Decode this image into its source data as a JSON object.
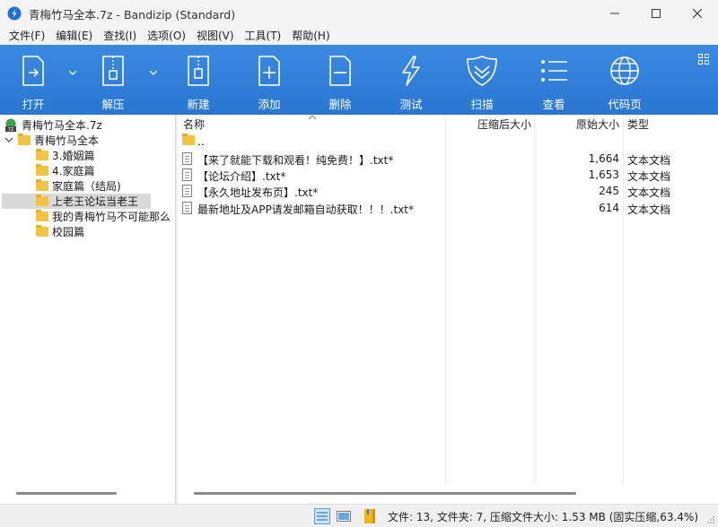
{
  "window": {
    "title": "青梅竹马全本.7z - Bandizip (Standard)"
  },
  "menu": [
    "文件(F)",
    "编辑(E)",
    "查找(I)",
    "选项(O)",
    "视图(V)",
    "工具(T)",
    "帮助(H)"
  ],
  "toolbar": {
    "items": [
      {
        "label": "打开",
        "icon": "open-icon"
      },
      {
        "label": "解压",
        "icon": "extract-icon"
      },
      {
        "label": "新建",
        "icon": "new-archive-icon"
      },
      {
        "label": "添加",
        "icon": "add-file-icon"
      },
      {
        "label": "删除",
        "icon": "delete-file-icon"
      },
      {
        "label": "测试",
        "icon": "test-icon"
      },
      {
        "label": "扫描",
        "icon": "scan-shield-icon"
      },
      {
        "label": "查看",
        "icon": "view-list-icon"
      },
      {
        "label": "代码页",
        "icon": "codepage-globe-icon"
      }
    ]
  },
  "tree": {
    "root": "青梅竹马全本.7z",
    "folder": "青梅竹马全本",
    "children": [
      "3.婚姻篇",
      "4.家庭篇",
      "家庭篇（结局)",
      "上老王论坛当老王",
      "我的青梅竹马不可能那么",
      "校园篇"
    ],
    "selected_index": 3
  },
  "columns": {
    "name": "名称",
    "compressed": "压缩后大小",
    "original": "原始大小",
    "type": "类型"
  },
  "files": [
    {
      "name": "..",
      "size": "",
      "type": "",
      "kind": "parent"
    },
    {
      "name": "【来了就能下载和观看！纯免费！】.txt*",
      "size": "1,664",
      "type": "文本文档",
      "kind": "doc"
    },
    {
      "name": "【论坛介绍】.txt*",
      "size": "1,653",
      "type": "文本文档",
      "kind": "doc"
    },
    {
      "name": "【永久地址发布页】.txt*",
      "size": "245",
      "type": "文本文档",
      "kind": "doc"
    },
    {
      "name": "最新地址及APP请发邮箱自动获取！！！.txt*",
      "size": "614",
      "type": "文本文档",
      "kind": "doc"
    }
  ],
  "status": {
    "text": "文件: 13, 文件夹: 7, 压缩文件大小: 1.53 MB (固实压缩,63.4%)"
  },
  "colors": {
    "toolbar": "#2f7ed8",
    "folder": "#f5c342",
    "selection": "#d9d9d9"
  }
}
